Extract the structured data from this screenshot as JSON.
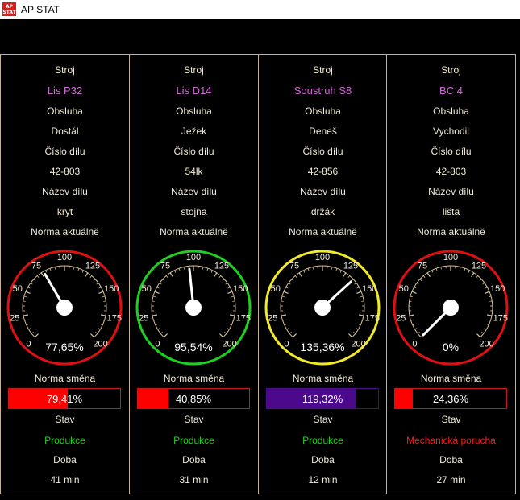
{
  "window": {
    "title": "AP STAT",
    "icon_text": "AP STAT"
  },
  "labels": {
    "stroj": "Stroj",
    "obsluha": "Obsluha",
    "cislo": "Číslo dílu",
    "nazev": "Název dílu",
    "norma_akt": "Norma aktuálně",
    "norma_smena": "Norma směna",
    "stav": "Stav",
    "doba": "Doba"
  },
  "gauge_ticks": [
    "0",
    "25",
    "50",
    "75",
    "100",
    "125",
    "150",
    "175",
    "200"
  ],
  "machines": [
    {
      "stroj": "Lis P32",
      "obsluha": "Dostál",
      "cislo": "42-803",
      "nazev": "kryt",
      "norma_akt_value": 77.65,
      "norma_akt_text": "77,65%",
      "ring_color": "#e01010",
      "norma_smena_value": 79.41,
      "norma_smena_text": "79,41%",
      "bar_color": "#ff0000",
      "bar_border": "#c81818",
      "stav": "Produkce",
      "stav_color": "#19d619",
      "doba": "41 min"
    },
    {
      "stroj": "Lis D14",
      "obsluha": "Ježek",
      "cislo": "54lk",
      "nazev": "stojna",
      "norma_akt_value": 95.54,
      "norma_akt_text": "95,54%",
      "ring_color": "#1ed01e",
      "norma_smena_value": 40.85,
      "norma_smena_text": "40,85%",
      "bar_color": "#ff0000",
      "bar_border": "#c81818",
      "stav": "Produkce",
      "stav_color": "#19d619",
      "doba": "31 min"
    },
    {
      "stroj": "Soustruh S8",
      "obsluha": "Deneš",
      "cislo": "42-856",
      "nazev": "držák",
      "norma_akt_value": 135.36,
      "norma_akt_text": "135,36%",
      "ring_color": "#f2ea28",
      "norma_smena_value": 119.32,
      "norma_smena_text": "119,32%",
      "bar_color": "#4b0a8c",
      "bar_border": "#4b0a8c",
      "stav": "Produkce",
      "stav_color": "#19d619",
      "doba": "12 min"
    },
    {
      "stroj": "BC 4",
      "obsluha": "Vychodil",
      "cislo": "42-803",
      "nazev": "lišta",
      "norma_akt_value": 0,
      "norma_akt_text": "0%",
      "ring_color": "#e01010",
      "norma_smena_value": 24.36,
      "norma_smena_text": "24,36%",
      "bar_color": "#ff0000",
      "bar_border": "#c81818",
      "stav": "Mechanická porucha",
      "stav_color": "#ff1a1a",
      "doba": "27 min"
    }
  ]
}
